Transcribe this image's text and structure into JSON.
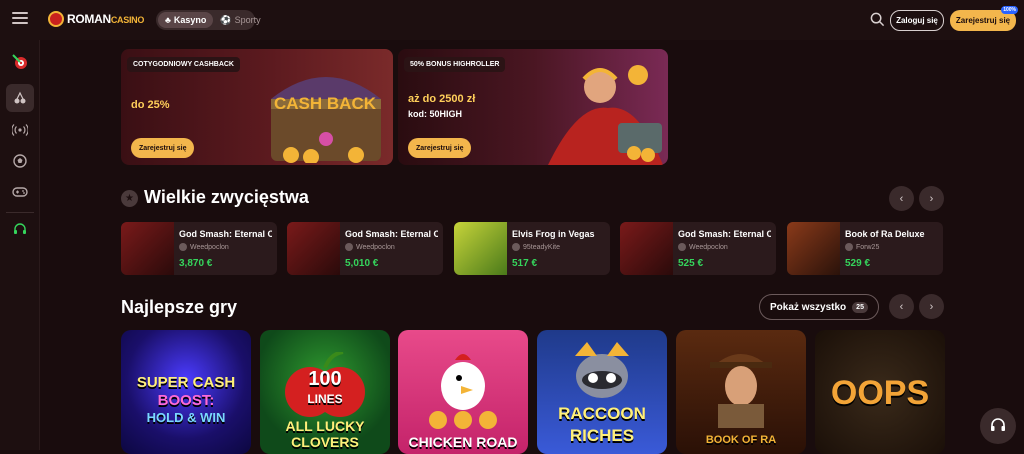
{
  "header": {
    "logo_main": "ROMAN",
    "logo_sub": "CASINO",
    "tabs": [
      {
        "label": "Kasyno",
        "active": true,
        "icon": "cards-icon"
      },
      {
        "label": "Sporty",
        "active": false,
        "icon": "football-icon"
      }
    ],
    "login_label": "Zaloguj się",
    "register_label": "Zarejestruj się",
    "register_badge": "100%"
  },
  "sidebar": {
    "items": [
      {
        "name": "darts-icon"
      },
      {
        "name": "cherry-icon"
      },
      {
        "name": "live-icon"
      },
      {
        "name": "football-icon"
      },
      {
        "name": "gamepad-icon"
      },
      {
        "name": "support-icon"
      }
    ]
  },
  "promos": [
    {
      "tag": "COTYGODNIOWY CASHBACK",
      "line1": "do 25%",
      "line2": "",
      "button": "Zarejestruj się",
      "art": "CASH BACK"
    },
    {
      "tag": "50% BONUS HIGHROLLER",
      "line1": "aż do 2500 zł",
      "line2": "kod: 50HIGH",
      "button": "Zarejestruj się",
      "art": ""
    }
  ],
  "big_wins": {
    "title": "Wielkie zwycięstwa",
    "cards": [
      {
        "game": "God Smash: Eternal C",
        "user": "Weedpoclon",
        "amount": "3,870 €"
      },
      {
        "game": "God Smash: Eternal C",
        "user": "Weedpoclon",
        "amount": "5,010 €"
      },
      {
        "game": "Elvis Frog in Vegas",
        "user": "95teadyKite",
        "amount": "517 €"
      },
      {
        "game": "God Smash: Eternal C",
        "user": "Weedpoclon",
        "amount": "525 €"
      },
      {
        "game": "Book of Ra Deluxe",
        "user": "Forw25",
        "amount": "529 €"
      }
    ]
  },
  "best_games": {
    "title": "Najlepsze gry",
    "show_all": "Pokaż wszystko",
    "count": "25",
    "tiles": [
      {
        "line1": "SUPER CASH",
        "line2": "BOOST:",
        "line3": "HOLD & WIN"
      },
      {
        "line1": "100",
        "line2": "LINES",
        "line3": "ALL LUCKY CLOVERS"
      },
      {
        "line1": "CHICKEN ROAD",
        "line2": "",
        "line3": ""
      },
      {
        "line1": "RACCOON",
        "line2": "RICHES",
        "line3": ""
      },
      {
        "line1": "BOOK OF RA",
        "line2": "",
        "line3": ""
      },
      {
        "line1": "OOPS",
        "line2": "",
        "line3": ""
      }
    ]
  },
  "colors": {
    "accent": "#f3b64c",
    "win": "#35d55c",
    "bg": "#190c0d"
  }
}
